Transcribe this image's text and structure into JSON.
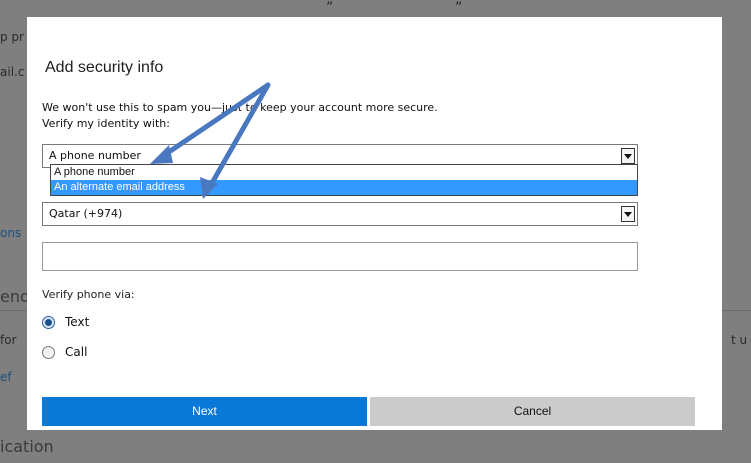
{
  "background": {
    "quote_marks": [
      "”",
      "”"
    ],
    "fragments": [
      "p pr",
      "ail.c",
      "ons",
      "end",
      "for",
      "ef",
      "t u",
      "ication"
    ]
  },
  "dialog": {
    "title": "Add security info",
    "intro": "We won't use this to spam you—just to keep your account more secure.",
    "verify_label": "Verify my identity with:",
    "method_select": {
      "value": "A phone number",
      "options": [
        "A phone number",
        "An alternate email address"
      ],
      "highlighted_index": 1
    },
    "country_select": {
      "value": "Qatar (+974)"
    },
    "phone_input": {
      "value": ""
    },
    "verify_phone_label": "Verify phone via:",
    "radio_options": [
      {
        "label": "Text",
        "checked": true
      },
      {
        "label": "Call",
        "checked": false
      }
    ],
    "buttons": {
      "next": "Next",
      "cancel": "Cancel"
    }
  },
  "colors": {
    "accent": "#0a78d7",
    "highlight": "#3399ff",
    "annotation_arrow": "#4a78c0"
  },
  "icons": [
    "chevron-down-icon",
    "radio-icon",
    "annotation-arrow"
  ]
}
